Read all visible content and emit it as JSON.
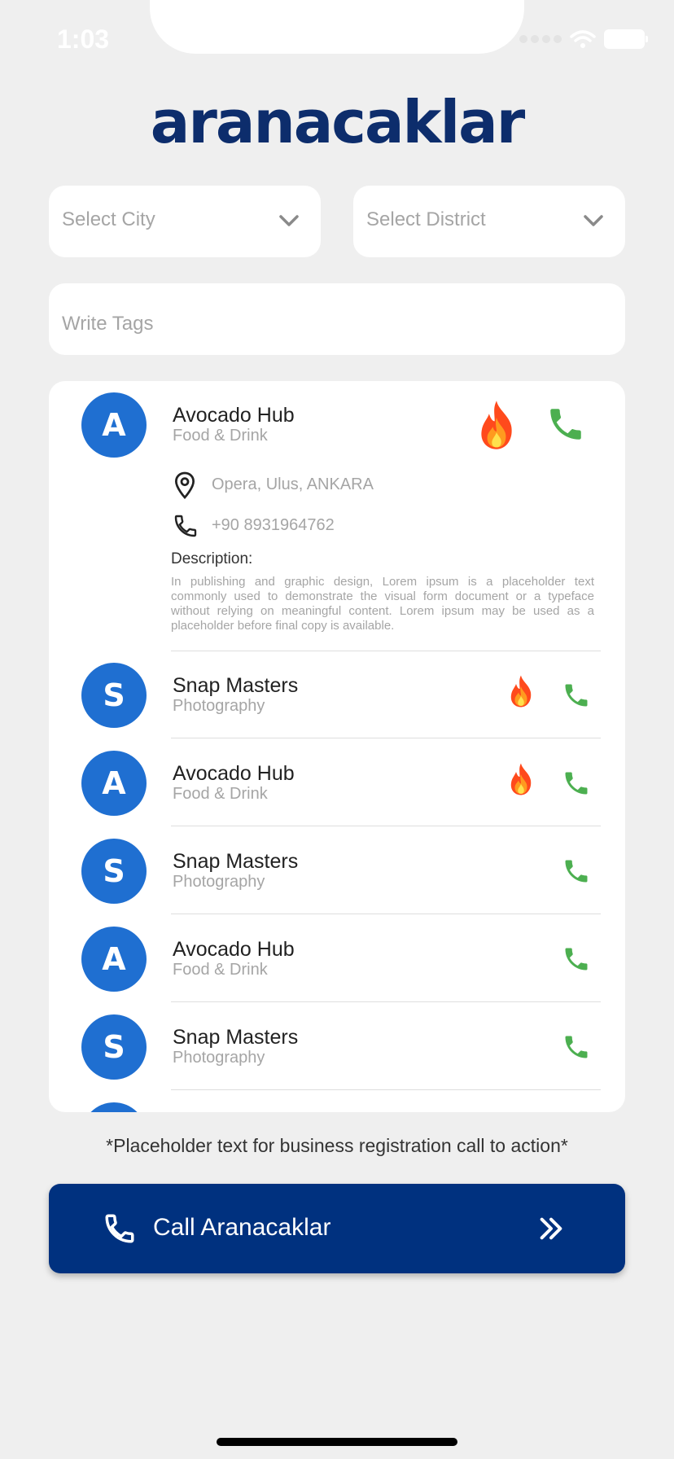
{
  "status_bar": {
    "time": "1:03"
  },
  "app": {
    "logo_text": "aranacaklar"
  },
  "filters": {
    "city_placeholder": "Select City",
    "district_placeholder": "Select District",
    "tags_placeholder": "Write Tags"
  },
  "businesses": [
    {
      "initial": "A",
      "name": "Avocado Hub",
      "category": "Food & Drink",
      "hot": true,
      "expanded": true,
      "address": "Opera, Ulus, ANKARA",
      "phone": "+90 8931964762",
      "description_title": "Description:",
      "description": "In publishing and graphic design, Lorem ipsum is a placeholder text commonly used to demonstrate the visual form document or a typeface without relying on meaningful content. Lorem ipsum may be used as a placeholder before final copy is available."
    },
    {
      "initial": "S",
      "name": "Snap Masters",
      "category": "Photography",
      "hot": true
    },
    {
      "initial": "A",
      "name": "Avocado Hub",
      "category": "Food & Drink",
      "hot": true
    },
    {
      "initial": "S",
      "name": "Snap Masters",
      "category": "Photography",
      "hot": false
    },
    {
      "initial": "A",
      "name": "Avocado Hub",
      "category": "Food & Drink",
      "hot": false
    },
    {
      "initial": "S",
      "name": "Snap Masters",
      "category": "Photography",
      "hot": false
    }
  ],
  "cta": {
    "note": "*Placeholder text for business registration call to action*",
    "button_label": "Call Aranacaklar"
  },
  "colors": {
    "brand": "#0d2d6c",
    "button": "#00317f",
    "avatar": "#1f6fd1",
    "call_green": "#4caf50",
    "background": "#efefef"
  },
  "icons": [
    "chevron-down-icon",
    "fire-icon",
    "phone-icon",
    "location-pin-icon",
    "double-chevron-right-icon"
  ]
}
